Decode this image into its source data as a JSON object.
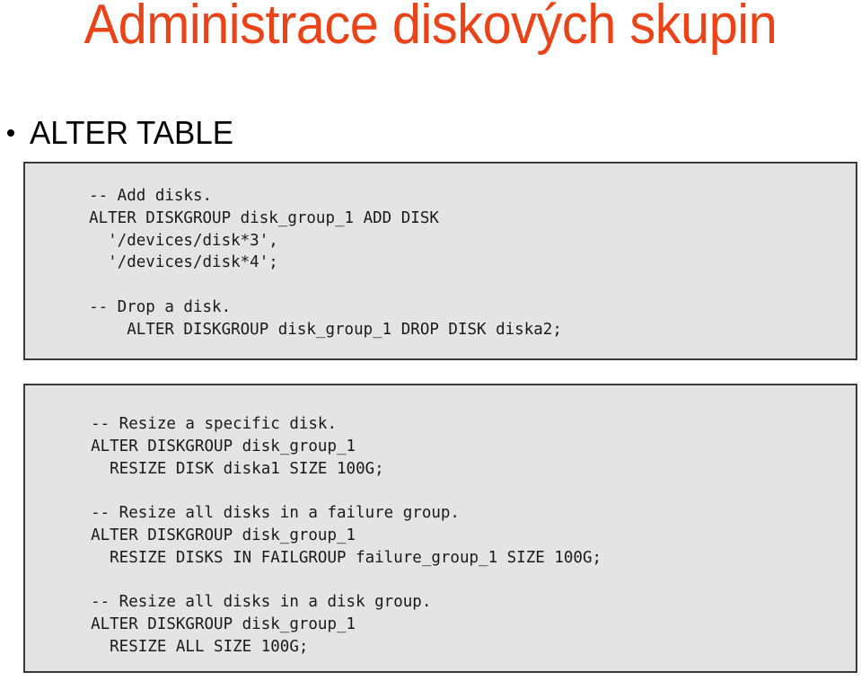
{
  "slide": {
    "title": "Administrace diskových skupin",
    "title_color": "#EA4318",
    "background_color": "#FFFFFF"
  },
  "bullets": [
    {
      "marker": "bullet-dot",
      "label": "ALTER TABLE"
    }
  ],
  "code_blocks": [
    {
      "name": "add-drop-disk-sql",
      "background_color": "#E4E4E4",
      "border_color": "#3A3A3A",
      "lines": [
        "  -- Add disks.",
        "  ALTER DISKGROUP disk_group_1 ADD DISK",
        "    '/devices/disk*3',",
        "    '/devices/disk*4';",
        "",
        "  -- Drop a disk.",
        "      ALTER DISKGROUP disk_group_1 DROP DISK diska2;"
      ]
    },
    {
      "name": "resize-disk-sql",
      "background_color": "#E4E4E4",
      "border_color": "#3A3A3A",
      "lines": [
        "  -- Resize a specific disk.",
        "  ALTER DISKGROUP disk_group_1",
        "    RESIZE DISK diska1 SIZE 100G;",
        "",
        "  -- Resize all disks in a failure group.",
        "  ALTER DISKGROUP disk_group_1",
        "    RESIZE DISKS IN FAILGROUP failure_group_1 SIZE 100G;",
        "",
        "  -- Resize all disks in a disk group.",
        "  ALTER DISKGROUP disk_group_1",
        "    RESIZE ALL SIZE 100G;"
      ]
    }
  ]
}
